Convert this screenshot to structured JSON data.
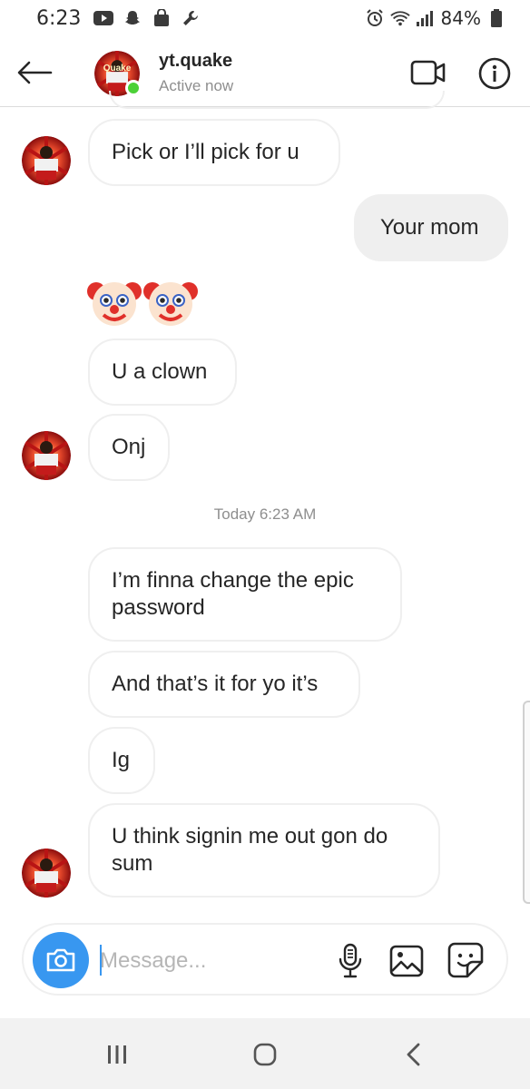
{
  "status_bar": {
    "time": "6:23",
    "battery": "84%"
  },
  "header": {
    "username": "yt.quake",
    "status": "Active now",
    "avatar_text": "Quake"
  },
  "messages": [
    {
      "id": "m1",
      "sender": "them",
      "text": "Pick or I’ll pick for u"
    },
    {
      "id": "m2",
      "sender": "me",
      "text": "Your mom"
    },
    {
      "id": "m3",
      "sender": "them",
      "text": "🤡🤡"
    },
    {
      "id": "m4",
      "sender": "them",
      "text": "U a clown"
    },
    {
      "id": "m5",
      "sender": "them",
      "text": "Onj"
    },
    {
      "id": "m6",
      "sender": "them",
      "text": "I’m finna change the epic password"
    },
    {
      "id": "m7",
      "sender": "them",
      "text": "And that’s it for yo it’s"
    },
    {
      "id": "m8",
      "sender": "them",
      "text": "Ig"
    },
    {
      "id": "m9",
      "sender": "them",
      "text": "U think signin me out gon do sum"
    }
  ],
  "timestamp_divider": "Today 6:23 AM",
  "composer": {
    "placeholder": "Message..."
  },
  "icons": {
    "back": "back-arrow-icon",
    "video": "video-camera-icon",
    "info": "info-icon",
    "camera": "camera-icon",
    "mic": "microphone-icon",
    "gallery": "gallery-icon",
    "sticker": "sticker-icon",
    "nav_recents": "recents-icon",
    "nav_home": "home-icon",
    "nav_back": "nav-back-icon"
  },
  "colors": {
    "accent_blue": "#3897f0",
    "online_green": "#4cd137",
    "bubble_border": "#efefef",
    "outgoing_bubble": "#efefef"
  }
}
